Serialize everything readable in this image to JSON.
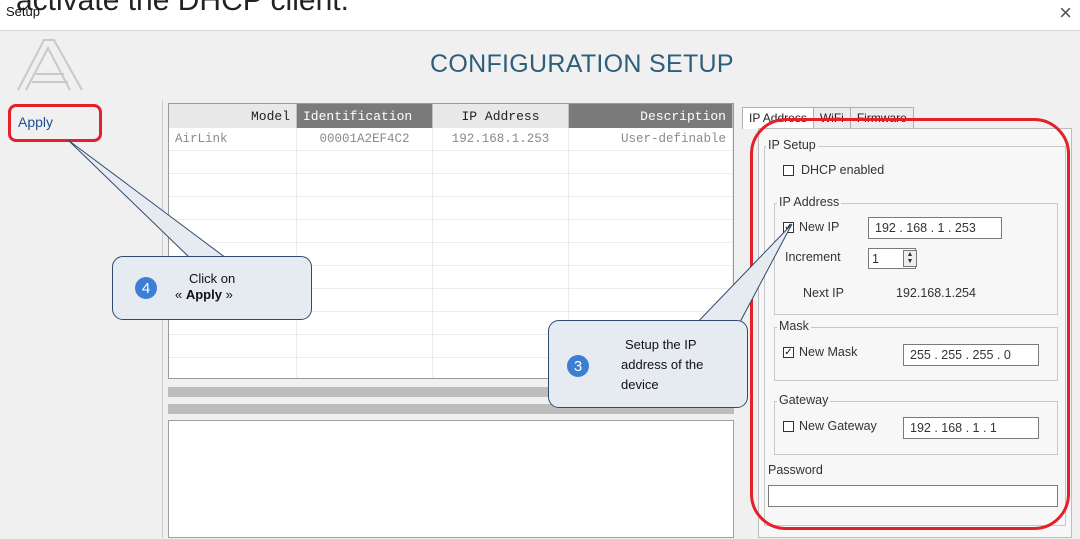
{
  "cutoff_text": "activate the DHCP client.",
  "window": {
    "title": "Setup",
    "close_glyph": "×"
  },
  "header": {
    "title": "CONFIGURATION SETUP"
  },
  "sidebar": {
    "apply_label": "Apply"
  },
  "device_table": {
    "columns": [
      "Model",
      "Identification",
      "IP Address",
      "Description"
    ],
    "rows": [
      [
        "AirLink",
        "00001A2EF4C2",
        "192.168.1.253",
        "User-definable"
      ]
    ]
  },
  "tabs": [
    "IP Address",
    "WiFi",
    "Firmware"
  ],
  "ip_panel": {
    "ip_setup_label": "IP Setup",
    "dhcp_label": "DHCP enabled",
    "dhcp_checked": false,
    "ip_address_group": "IP Address",
    "new_ip_label": "New IP",
    "new_ip_checked": true,
    "new_ip_value": "192 . 168 .  1  . 253",
    "increment_label": "Increment",
    "increment_value": "1",
    "next_ip_label": "Next IP",
    "next_ip_value": "192.168.1.254",
    "mask_group": "Mask",
    "new_mask_label": "New Mask",
    "new_mask_checked": true,
    "new_mask_value": "255 . 255 . 255 .  0",
    "gateway_group": "Gateway",
    "new_gateway_label": "New Gateway",
    "new_gateway_checked": false,
    "new_gateway_value": "192 . 168 .  1  .  1",
    "password_label": "Password"
  },
  "callouts": {
    "apply": {
      "number": "4",
      "line1": "Click on",
      "prefix": "« ",
      "bold": "Apply",
      "suffix": " »"
    },
    "setup": {
      "number": "3",
      "line1": "Setup  the IP",
      "line2": "address of the",
      "line3": "device"
    }
  },
  "colors": {
    "highlight": "#e2212a",
    "badge": "#3b7fd4",
    "heading": "#2e5f7a",
    "callout_fill": "#e6eaf1"
  },
  "icons": [
    "close-icon",
    "app-logo-icon",
    "checkbox-icon",
    "spinner-icon"
  ]
}
